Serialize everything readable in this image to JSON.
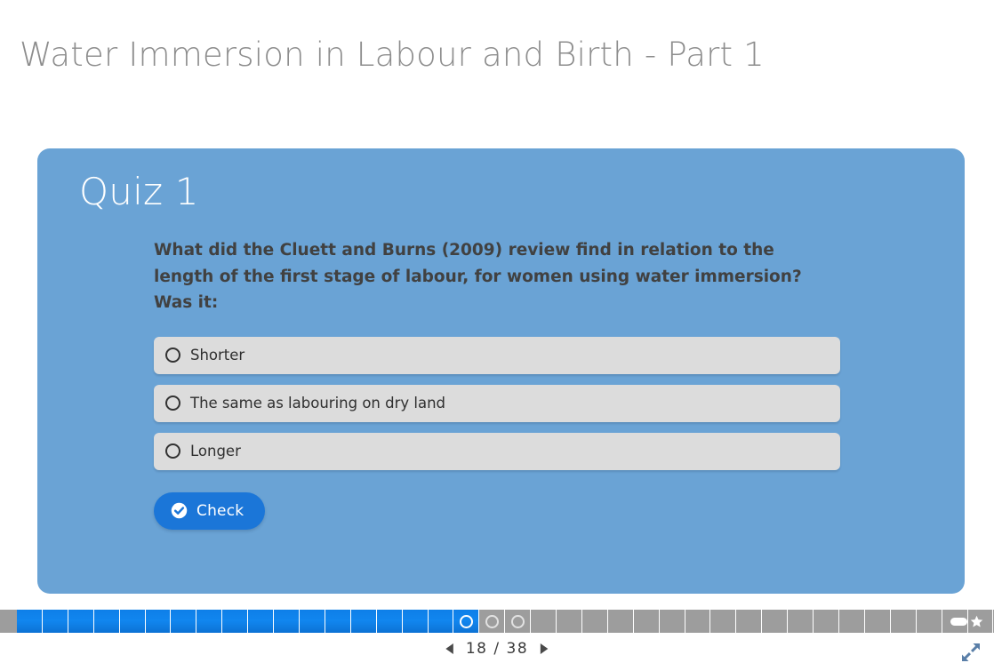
{
  "header": {
    "title": "Water Immersion in Labour and Birth - Part 1"
  },
  "quiz": {
    "heading": "Quiz 1",
    "question": "What did the Cluett and Burns (2009) review find in relation to the length of the first stage of labour, for women using water immersion? Was it:",
    "options": [
      {
        "label": "Shorter",
        "selected": false
      },
      {
        "label": "The same as labouring on dry land",
        "selected": false
      },
      {
        "label": "Longer",
        "selected": false
      }
    ],
    "check_button": {
      "label": "Check",
      "icon": "check-circle-icon"
    },
    "colors": {
      "panel": "#6aa3d5",
      "option": "#dcdcdc",
      "button": "#1b76d8",
      "question_text": "#414141"
    }
  },
  "progress": {
    "total_segments": 38,
    "visited_segments": 18,
    "markers_at": [
      18,
      19,
      20
    ],
    "end_icons": [
      "pill-icon",
      "star-icon"
    ],
    "colors": {
      "visited": "#0e7fe8",
      "unvisited": "#9d9d9d"
    }
  },
  "footer": {
    "prev_icon": "triangle-left-icon",
    "next_icon": "triangle-right-icon",
    "counter": "18 / 38",
    "current_page": 18,
    "total_pages": 38,
    "fullscreen_icon": "expand-arrows-icon"
  }
}
